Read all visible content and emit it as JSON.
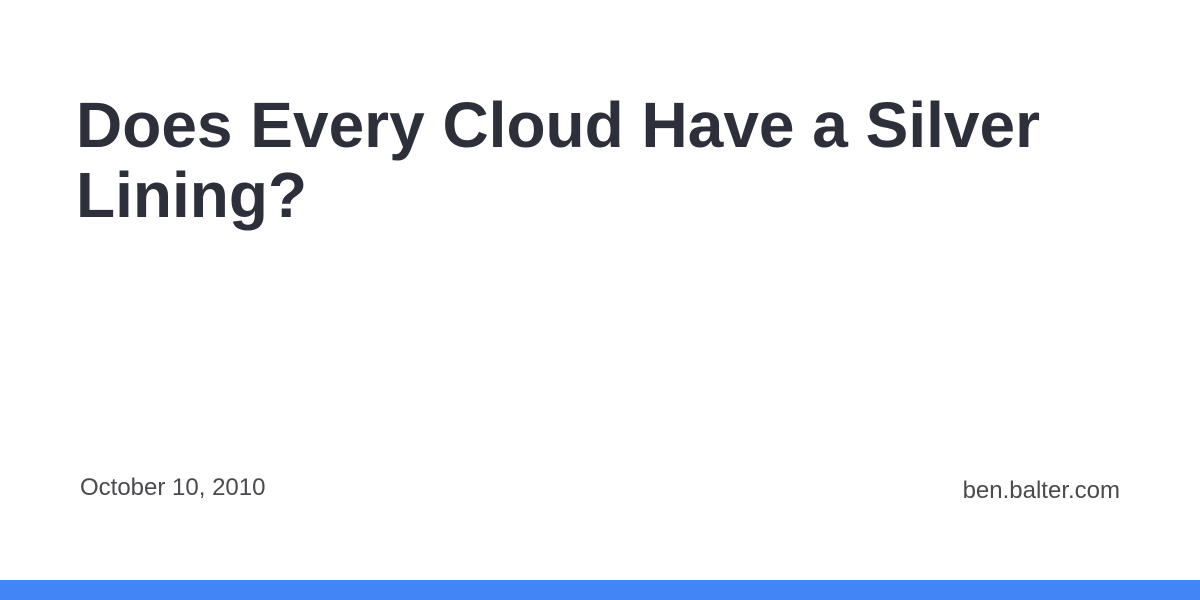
{
  "post": {
    "title": "Does Every Cloud Have a Silver Lining?",
    "date": "October 10, 2010"
  },
  "site": {
    "domain": "ben.balter.com"
  },
  "colors": {
    "title": "#2d2f3a",
    "meta_text": "#4a4a4f",
    "accent_bar": "#4285f4",
    "background": "#ffffff"
  }
}
